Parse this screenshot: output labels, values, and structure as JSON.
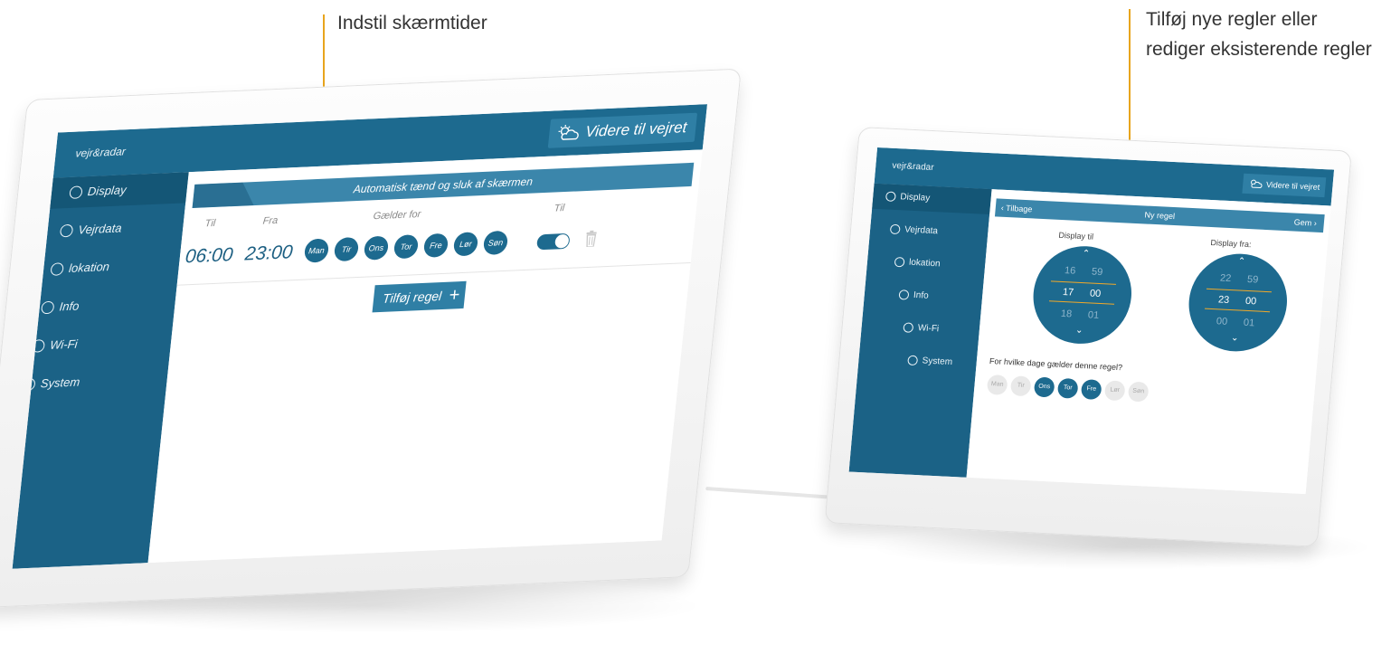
{
  "callouts": {
    "left": "Indstil skærmtider",
    "right_line1": "Tilføj nye regler eller",
    "right_line2": "rediger eksisterende regler"
  },
  "left_device": {
    "brand": "vejr&radar",
    "weather_button": "Videre til vejret",
    "sidebar": [
      {
        "label": "Display",
        "icon": "power-icon",
        "active": true
      },
      {
        "label": "Vejrdata",
        "icon": "ellipsis-icon",
        "active": false
      },
      {
        "label": "lokation",
        "icon": "location-icon",
        "active": false
      },
      {
        "label": "Info",
        "icon": "bulb-icon",
        "active": false
      },
      {
        "label": "Wi-Fi",
        "icon": "wifi-icon",
        "active": false
      },
      {
        "label": "System",
        "icon": "check-icon",
        "active": false
      }
    ],
    "panel_title": "Automatisk tænd og sluk af skærmen",
    "columns": {
      "til": "Til",
      "fra": "Fra",
      "gaelder": "Gælder for",
      "til2": "Til"
    },
    "rule": {
      "til_time": "06:00",
      "fra_time": "23:00",
      "days": [
        "Man",
        "Tir",
        "Ons",
        "Tor",
        "Fre",
        "Lør",
        "Søn"
      ],
      "enabled": true
    },
    "add_button": "Tilføj regel",
    "add_icon": "+"
  },
  "right_device": {
    "brand": "vejr&radar",
    "weather_button": "Videre til vejret",
    "sidebar": [
      {
        "label": "Display",
        "icon": "power-icon",
        "active": true
      },
      {
        "label": "Vejrdata",
        "icon": "ellipsis-icon",
        "active": false
      },
      {
        "label": "lokation",
        "icon": "location-icon",
        "active": false
      },
      {
        "label": "Info",
        "icon": "bulb-icon",
        "active": false
      },
      {
        "label": "Wi-Fi",
        "icon": "wifi-icon",
        "active": false
      },
      {
        "label": "System",
        "icon": "check-icon",
        "active": false
      }
    ],
    "header": {
      "back": "Tilbage",
      "title": "Ny regel",
      "save": "Gem"
    },
    "dial_til": {
      "label": "Display til",
      "hours": [
        "16",
        "17",
        "18"
      ],
      "minutes": [
        "59",
        "00",
        "01"
      ]
    },
    "dial_fra": {
      "label": "Display fra:",
      "hours": [
        "22",
        "23",
        "00"
      ],
      "minutes": [
        "59",
        "00",
        "01"
      ]
    },
    "days_question": "For hvilke dage gælder denne regel?",
    "days": [
      {
        "label": "Man",
        "on": false
      },
      {
        "label": "Tir",
        "on": false
      },
      {
        "label": "Ons",
        "on": true
      },
      {
        "label": "Tor",
        "on": true
      },
      {
        "label": "Fre",
        "on": true
      },
      {
        "label": "Lør",
        "on": false
      },
      {
        "label": "Søn",
        "on": false
      }
    ]
  },
  "colors": {
    "accent": "#f0a92a",
    "primary": "#1d6a8f",
    "sidebar": "#1b6286",
    "header": "#3b86ab"
  }
}
